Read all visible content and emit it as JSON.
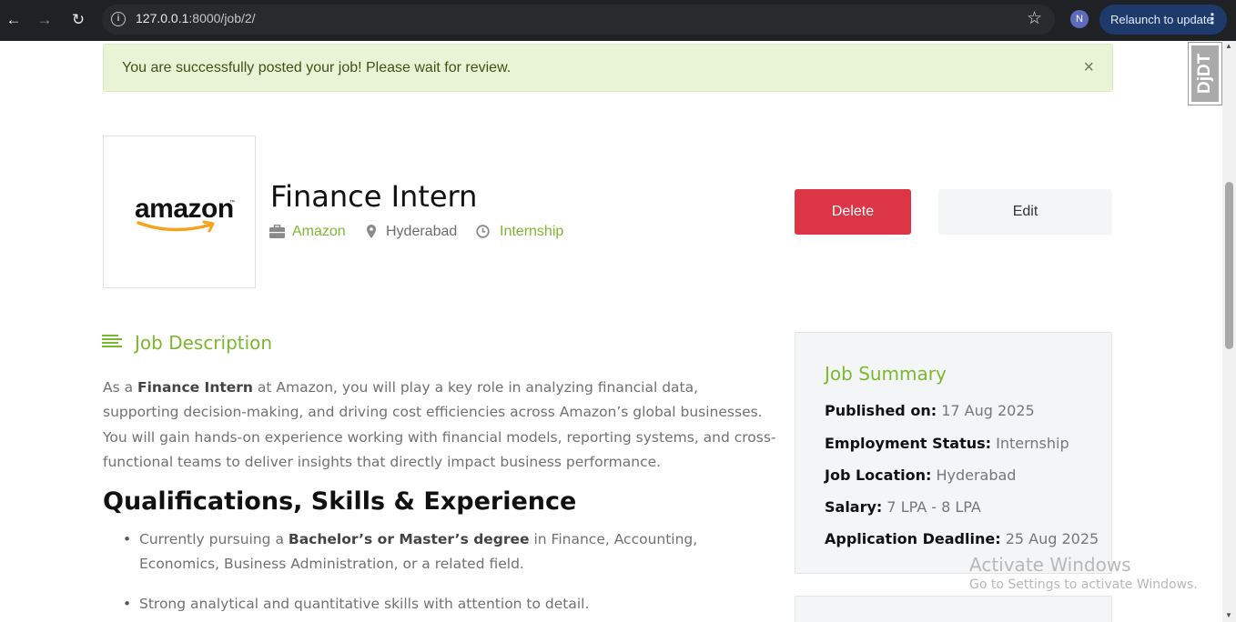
{
  "browser": {
    "url_host": "127.0.0.1",
    "url_path": ":8000/job/2/",
    "profile_initial": "N",
    "relaunch_label": "Relaunch to update"
  },
  "debug_toolbar": {
    "label": "DjDT"
  },
  "alert": {
    "message": "You are successfully posted your job! Please wait for review.",
    "close": "×"
  },
  "job": {
    "logo_text": "amazon",
    "title": "Finance Intern",
    "company": "Amazon",
    "location": "Hyderabad",
    "type": "Internship",
    "delete_label": "Delete",
    "edit_label": "Edit"
  },
  "description": {
    "heading": "Job Description",
    "intro_prefix": "As a ",
    "intro_bold": "Finance Intern",
    "intro_rest": " at Amazon, you will play a key role in analyzing financial data, supporting decision-making, and driving cost efficiencies across Amazon’s global businesses. You will gain hands-on experience working with financial models, reporting systems, and cross-functional teams to deliver insights that directly impact business performance.",
    "qual_heading": "Qualifications, Skills & Experience",
    "qual_1_prefix": "Currently pursuing a ",
    "qual_1_bold": "Bachelor’s or Master’s degree",
    "qual_1_rest": " in Finance, Accounting, Economics, Business Administration, or a related field.",
    "qual_2": "Strong analytical and quantitative skills with attention to detail."
  },
  "summary": {
    "title": "Job Summary",
    "published_label": "Published on:",
    "published_value": "17 Aug 2025",
    "status_label": "Employment Status:",
    "status_value": "Internship",
    "location_label": "Job Location:",
    "location_value": "Hyderabad",
    "salary_label": "Salary:",
    "salary_value": "7 LPA - 8 LPA",
    "deadline_label": "Application Deadline:",
    "deadline_value": "25 Aug 2025"
  },
  "watermark": {
    "line1": "Activate Windows",
    "line2": "Go to Settings to activate Windows."
  },
  "colors": {
    "accent": "#7cb82f",
    "danger": "#dc3545",
    "alert_bg": "#e9f4d7"
  }
}
